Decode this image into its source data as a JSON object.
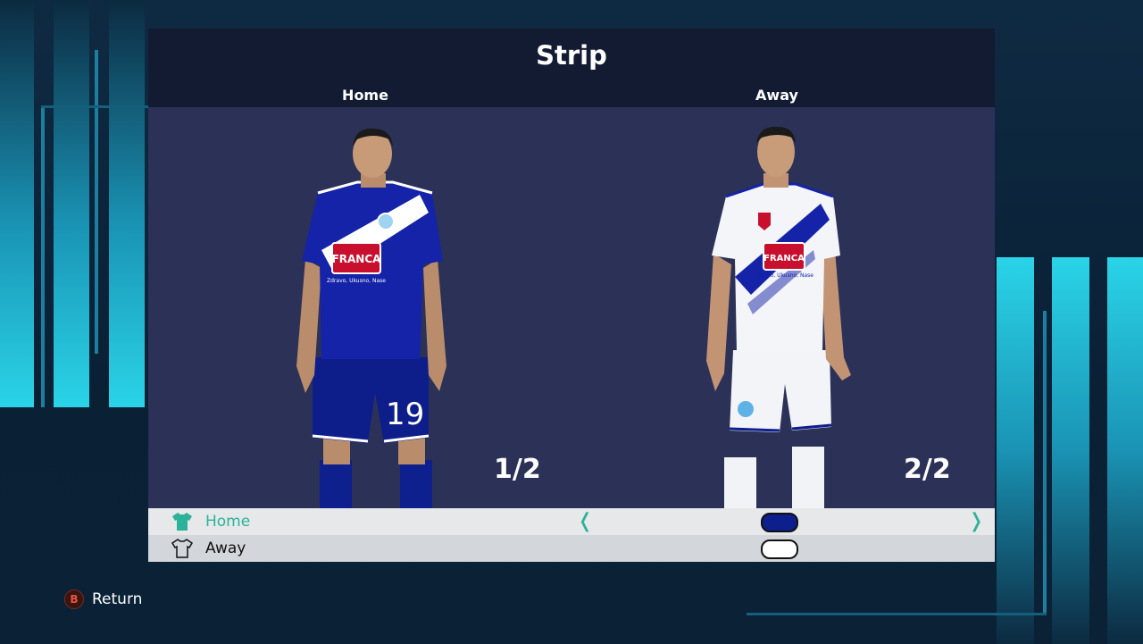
{
  "screen": {
    "title": "Strip"
  },
  "columns": {
    "home": "Home",
    "away": "Away"
  },
  "counters": {
    "home": "1/2",
    "away": "2/2"
  },
  "home_kit": {
    "sponsor": "FRANCA",
    "sponsor_tagline": "Zdravo, Ukusno, Nase",
    "number": "19"
  },
  "away_kit": {
    "sponsor": "FRANCA",
    "sponsor_tagline": "Zdravo, Ukusno, Nase"
  },
  "options": [
    {
      "label": "Home",
      "selected": true,
      "swatch": "#0c1f8c",
      "icon": "shirt-icon"
    },
    {
      "label": "Away",
      "selected": false,
      "swatch": "#ffffff",
      "icon": "shirt-outline-icon"
    }
  ],
  "nav": {
    "prev_arrow": "❬",
    "next_arrow": "❭"
  },
  "footer": {
    "button_glyph": "B",
    "return_label": "Return"
  },
  "colors": {
    "accent": "#2cb29a",
    "panel_header": "#131b33",
    "stage": "#2c3157",
    "cyan": "#2ad4e8"
  }
}
